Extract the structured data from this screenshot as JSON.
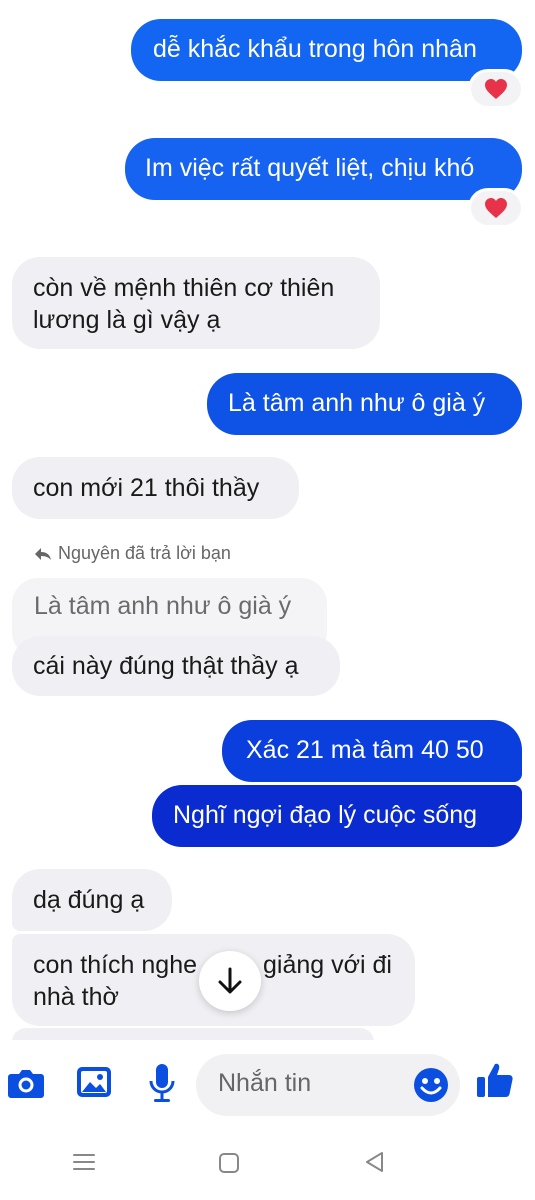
{
  "colors": {
    "accent": "#0a5ef0",
    "outgoing_top": "#1264f0",
    "outgoing_bottom": "#0b2fd0",
    "incoming_bg": "#f0f0f4",
    "heart": "#e8324a"
  },
  "messages": [
    {
      "id": "m1",
      "side": "out",
      "text": "dễ khắc khẩu trong hôn nhân",
      "reaction": "heart-icon"
    },
    {
      "id": "m2",
      "side": "out",
      "text": "Im việc rất quyết liệt, chịu khó",
      "reaction": "heart-icon"
    },
    {
      "id": "m3",
      "side": "in",
      "text": "còn về mệnh thiên cơ thiên lương là gì vậy ạ"
    },
    {
      "id": "m4",
      "side": "out",
      "text": "Là tâm anh như ô già ý"
    },
    {
      "id": "m5",
      "side": "in",
      "text": "con mới 21 thôi thầy"
    },
    {
      "id": "m6",
      "side": "in",
      "text": "cái này đúng thật thầy ạ"
    },
    {
      "id": "m7",
      "side": "out",
      "text": "Xác 21 mà tâm 40 50"
    },
    {
      "id": "m8",
      "side": "out",
      "text": "Nghĩ ngợi đạo lý cuộc sống"
    },
    {
      "id": "m9",
      "side": "in",
      "text": "dạ đúng ạ"
    },
    {
      "id": "m10",
      "side": "in",
      "text_before": "con thích nghe",
      "text_after": "giảng với đi",
      "text_line2": "nhà thờ"
    }
  ],
  "reply": {
    "label": "Nguyên đã trả lời bạn",
    "quoted": "Là tâm anh như ô già ý"
  },
  "composer": {
    "placeholder": "Nhắn tin",
    "icons": [
      "camera-icon",
      "image-icon",
      "microphone-icon",
      "emoji-icon",
      "thumbs-up-icon"
    ]
  },
  "navbar": {
    "icons": [
      "menu-icon",
      "home-icon",
      "back-icon"
    ]
  }
}
